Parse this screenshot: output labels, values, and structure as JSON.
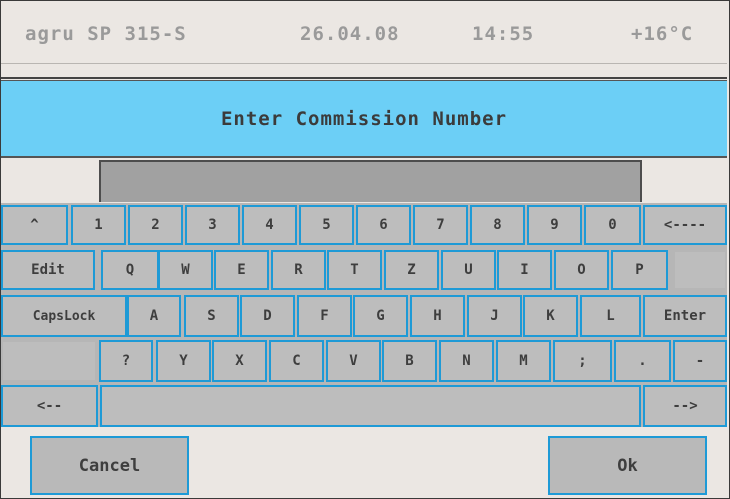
{
  "status": {
    "device": "agru SP 315-S",
    "date": "26.04.08",
    "time": "14:55",
    "temperature": "+16°C"
  },
  "title": "Enter Commission Number",
  "input": {
    "value": ""
  },
  "keyboard": {
    "row1": [
      "^",
      "1",
      "2",
      "3",
      "4",
      "5",
      "6",
      "7",
      "8",
      "9",
      "0",
      "<----"
    ],
    "row2": [
      "Edit",
      "Q",
      "W",
      "E",
      "R",
      "T",
      "Z",
      "U",
      "I",
      "O",
      "P",
      ""
    ],
    "row3": [
      "CapsLock",
      "A",
      "S",
      "D",
      "F",
      "G",
      "H",
      "J",
      "K",
      "L",
      "Enter"
    ],
    "row4": [
      "",
      "?",
      "Y",
      "X",
      "C",
      "V",
      "B",
      "N",
      "M",
      ";",
      ".",
      "-"
    ],
    "row5": [
      "<--",
      "",
      "-->"
    ]
  },
  "buttons": {
    "cancel": "Cancel",
    "ok": "Ok"
  },
  "colors": {
    "accent": "#1e9ad6",
    "title_bg": "#6ccff6",
    "key_bg": "#bdbdbd"
  }
}
